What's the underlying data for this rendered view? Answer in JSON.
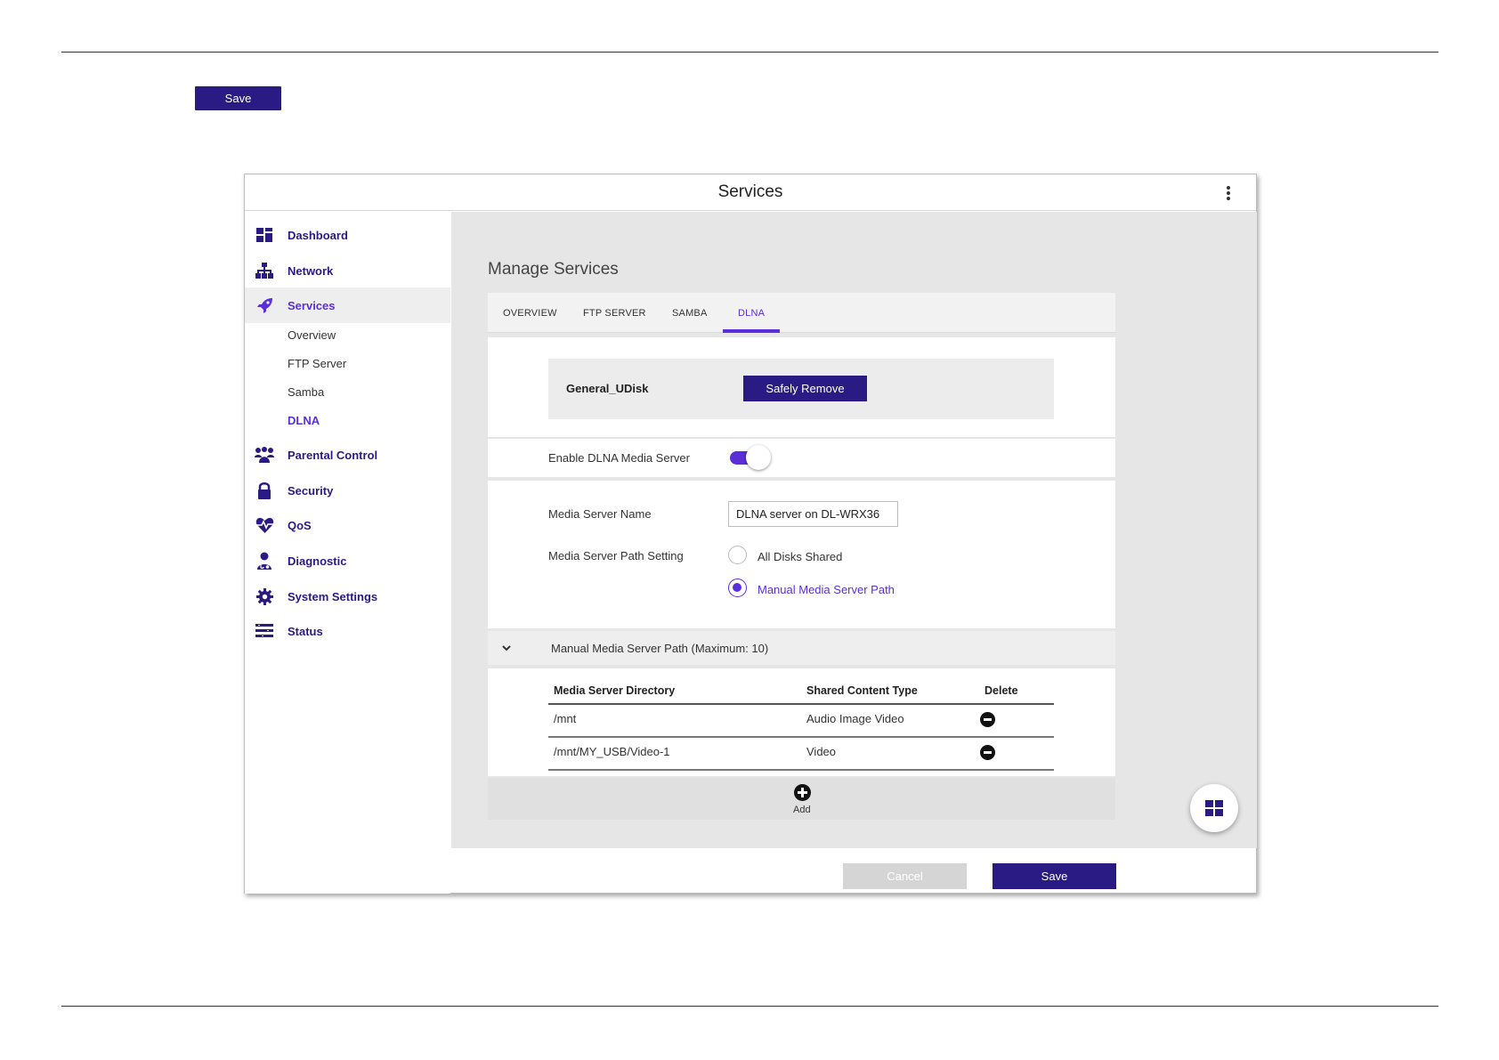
{
  "document": {
    "save_label": "Save"
  },
  "window": {
    "title": "Services"
  },
  "sidebar": {
    "items": [
      {
        "label": "Dashboard",
        "icon": "dashboard-icon"
      },
      {
        "label": "Network",
        "icon": "network-icon"
      },
      {
        "label": "Services",
        "icon": "rocket-icon",
        "active": true
      },
      {
        "label": "Parental Control",
        "icon": "users-icon"
      },
      {
        "label": "Security",
        "icon": "lock-icon"
      },
      {
        "label": "QoS",
        "icon": "heartbeat-icon"
      },
      {
        "label": "Diagnostic",
        "icon": "doctor-icon"
      },
      {
        "label": "System Settings",
        "icon": "gear-icon"
      },
      {
        "label": "Status",
        "icon": "list-icon"
      }
    ],
    "subitems": [
      {
        "label": "Overview"
      },
      {
        "label": "FTP Server"
      },
      {
        "label": "Samba"
      },
      {
        "label": "DLNA",
        "active": true
      }
    ]
  },
  "main": {
    "heading": "Manage Services",
    "tabs": [
      {
        "label": "OVERVIEW"
      },
      {
        "label": "FTP SERVER"
      },
      {
        "label": "SAMBA"
      },
      {
        "label": "DLNA",
        "active": true
      }
    ],
    "disk": {
      "name": "General_UDisk",
      "remove_label": "Safely Remove"
    },
    "enable_dlna": {
      "label": "Enable DLNA Media Server",
      "enabled": true
    },
    "server_name": {
      "label": "Media Server Name",
      "value": "DLNA server on DL-WRX36"
    },
    "path_setting": {
      "label": "Media Server Path Setting",
      "options": [
        {
          "label": "All Disks Shared",
          "selected": false
        },
        {
          "label": "Manual Media Server Path",
          "selected": true
        }
      ]
    },
    "manual_path": {
      "title": "Manual Media Server Path (Maximum: 10)",
      "columns": [
        "Media Server Directory",
        "Shared Content Type",
        "Delete"
      ],
      "rows": [
        {
          "directory": "/mnt",
          "type": "Audio Image Video"
        },
        {
          "directory": "/mnt/MY_USB/Video-1",
          "type": "Video"
        }
      ],
      "add_label": "Add"
    }
  },
  "footer": {
    "cancel_label": "Cancel",
    "save_label": "Save"
  },
  "colors": {
    "brand": "#2a1a83",
    "accent": "#5a2fd8",
    "panel": "#e6e6e6"
  }
}
